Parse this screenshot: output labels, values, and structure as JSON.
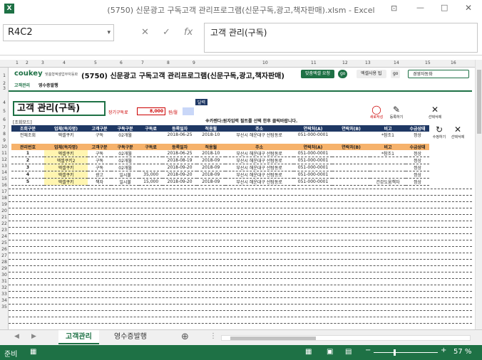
{
  "window": {
    "title": "(5750) 신문광고 구독고객 관리프로그램(신문구독,광고,책자판매).xlsm - Excel"
  },
  "formula_bar": {
    "name_box": "R4C2",
    "content": "고객 관리(구독)",
    "fx": "fx",
    "cancel": "✕",
    "enter": "✓"
  },
  "col_headers": [
    "1",
    "2",
    "3",
    "4",
    "5",
    "6",
    "7",
    "8",
    "9",
    "10",
    "11",
    "12",
    "13",
    "14",
    "15",
    "16"
  ],
  "row_headers": [
    "1",
    "2",
    "3",
    "4",
    "5",
    "6",
    "7",
    "8",
    "9",
    "10",
    "11",
    "12",
    "13",
    "14",
    "15",
    "16",
    "17",
    "18",
    "19",
    "20",
    "21",
    "22",
    "23",
    "24",
    "25",
    "26",
    "27",
    "28",
    "29",
    "30",
    "31",
    "32",
    "33",
    "34",
    "35"
  ],
  "banner": {
    "brand": "coukey",
    "brand_sub": "맞춤형엑셀업무자동화",
    "title": "(5750) 신문광고 구독고객 관리프로그램(신문구독,광고,책자판매)",
    "btn_request": "맞춤엑셀 요청",
    "btn_go1": "go",
    "btn_tip": "엑셀사용 팁",
    "btn_go2": "go",
    "company": "경영자동화"
  },
  "top_tabs": [
    "고객관리",
    "영수증발행"
  ],
  "page_title": "고객 관리(구독)",
  "fee_label": "장기구독료",
  "fee_value": "8,000",
  "fee_unit": "원/월",
  "tooltip": "달력",
  "notice": "※카렌다:원자입력 필트를 선택 한후 클릭바랍니다.",
  "search_mode": "[조회모드]",
  "buttons": {
    "new": "새로작성",
    "register": "등록하기",
    "delete": "선택삭제",
    "edit": "수정하기",
    "delete2": "선택삭제"
  },
  "search": {
    "headers": [
      "조회구분",
      "업체(독자명)",
      "고객구분",
      "구독구분",
      "구독료",
      "등록일자",
      "적용월",
      "주소",
      "연락처(A)",
      "연락처(B)",
      "비고",
      "수금상태"
    ],
    "values": [
      "전체조회",
      "엑셀쿠키",
      "구독",
      "02개월",
      "",
      "2018-06-25",
      "2018-10",
      "부산시 해운대구 선텀동로",
      "051-000-0001",
      "",
      "*참조1",
      "정상"
    ]
  },
  "list": {
    "headers": [
      "관리번호",
      "업체(독자명)",
      "고객구분",
      "구독구분",
      "구독료",
      "등록일자",
      "적용월",
      "주소",
      "연락처(A)",
      "연락처(B)",
      "비고",
      "수금상태"
    ],
    "rows": [
      [
        "1",
        "엑셀쿠키",
        "구독",
        "02개월",
        "",
        "2018-06-25",
        "2018-10",
        "부산시 해운대구 선텀동로",
        "051-000-0001",
        "",
        "*참조1",
        "정상"
      ],
      [
        "2",
        "엑셀쿠키2",
        "구독",
        "02개월",
        "",
        "2018-08-19",
        "2018-09",
        "부산시 해운대구 선텀동로",
        "051-000-0001",
        "",
        "",
        "정상"
      ],
      [
        "3",
        "엑셀쿠키",
        "구독",
        "02개월",
        "",
        "2018-09-20",
        "2018-09",
        "부산시 해운대구 선텀동로",
        "051-000-0001",
        "",
        "",
        "정상"
      ],
      [
        "4",
        "엑셀쿠키",
        "광고",
        "일시불",
        "35,000",
        "2018-09-20",
        "2018-09",
        "부산시 해운대구 선텀동로",
        "051-000-0001",
        "",
        "",
        "정상"
      ],
      [
        "5",
        "엑셀쿠키",
        "책자",
        "일시불",
        "15,000",
        "2018-09-20",
        "2018-09",
        "부산시 해운대구 선텀동로",
        "051-000-0001",
        "",
        "건강도움책자",
        "정상"
      ]
    ]
  },
  "sheet_tabs": [
    "고객관리",
    "영수증발행"
  ],
  "status": {
    "ready": "준비",
    "zoom": "57 %"
  }
}
